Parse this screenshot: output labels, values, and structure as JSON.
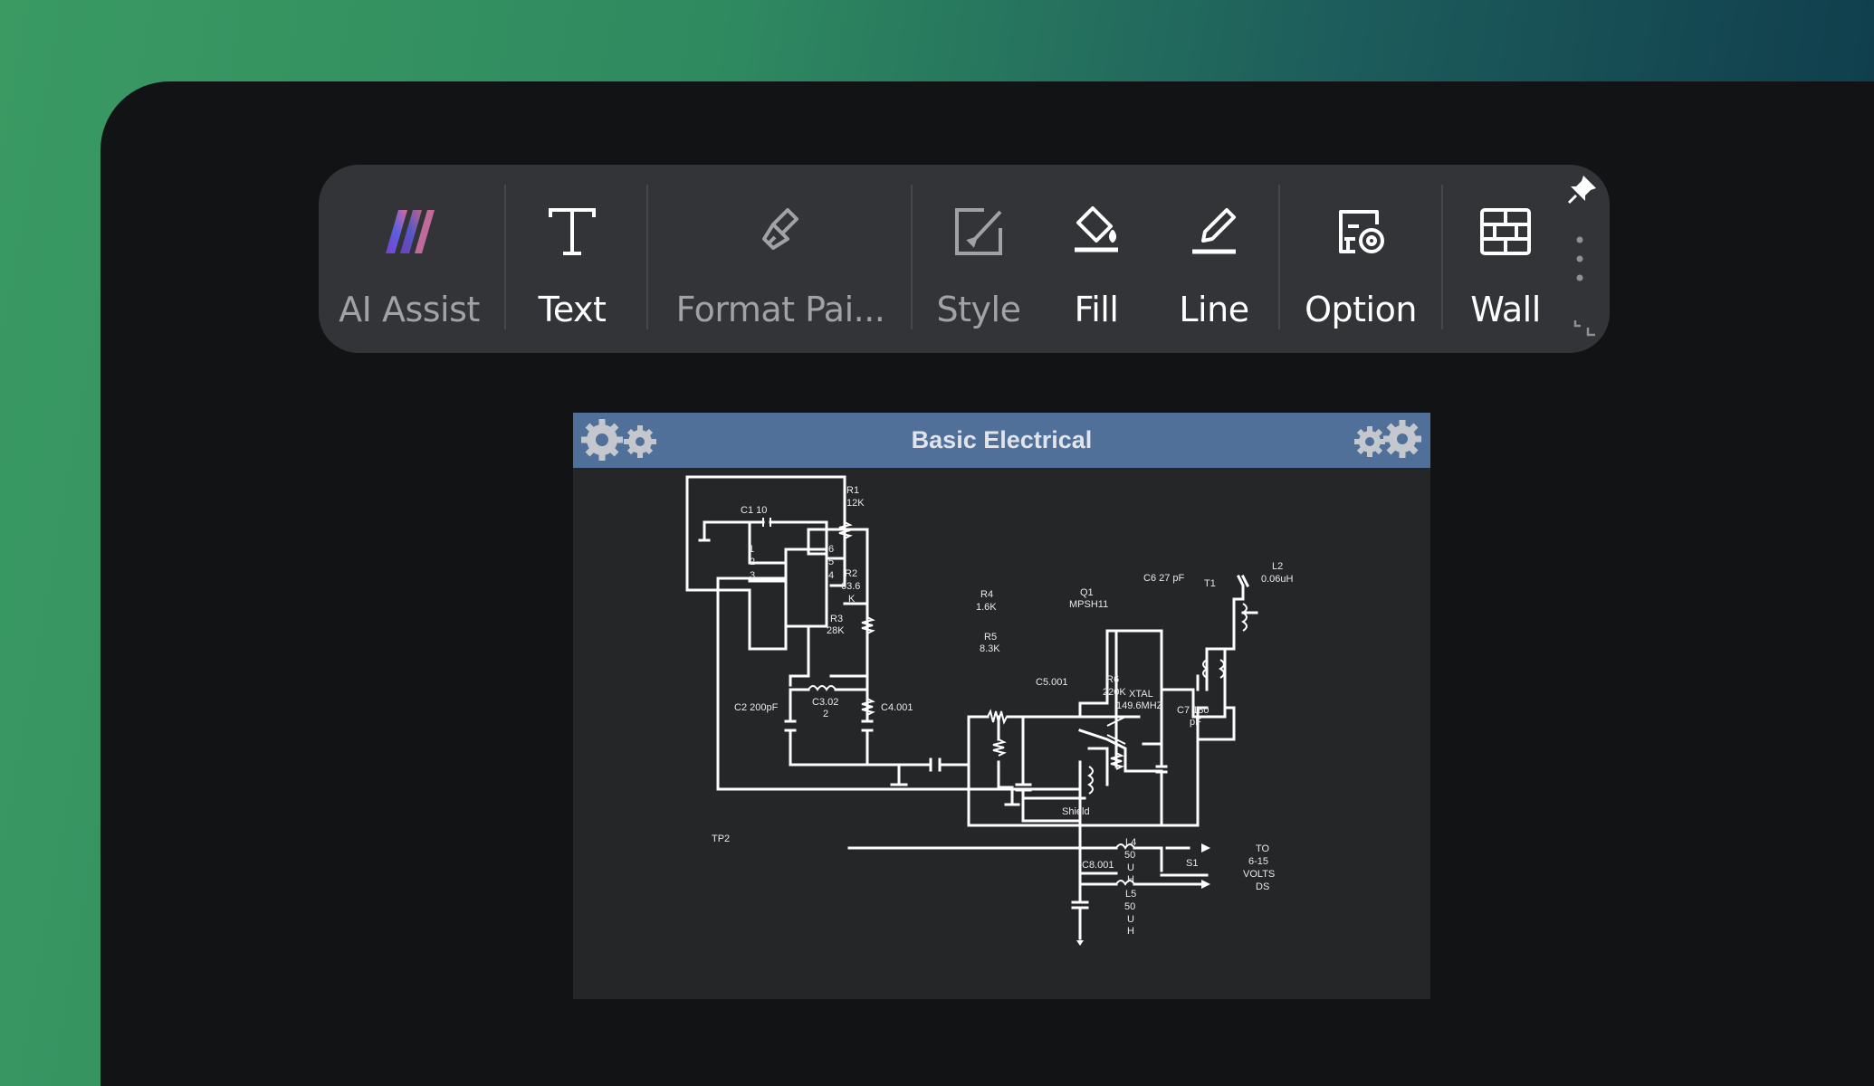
{
  "toolbar": {
    "tools": [
      {
        "label": "AI Assist",
        "icon": "ai-assist-icon"
      },
      {
        "label": "Text",
        "icon": "text-icon"
      },
      {
        "label": "Format Pai...",
        "icon": "paintbrush-icon"
      },
      {
        "label": "Style",
        "icon": "style-icon"
      },
      {
        "label": "Fill",
        "icon": "paint-bucket-icon"
      },
      {
        "label": "Line",
        "icon": "pen-line-icon"
      },
      {
        "label": "Option",
        "icon": "option-gear-icon"
      },
      {
        "label": "Wall",
        "icon": "wall-icon"
      }
    ],
    "pin_icon": "pin-icon",
    "more_icon": "more-vertical-icon"
  },
  "canvas": {
    "title": "Basic Electrical",
    "colors": {
      "header": "#50709a",
      "background": "#252628",
      "wire": "#ffffff"
    }
  },
  "schematic": {
    "labels": {
      "c1": "C1 10",
      "r1a": "R1",
      "r1b": "12K",
      "r2a": "R2",
      "r2b": "63.6",
      "r2c": "K",
      "r3a": "R3",
      "r3b": "28K",
      "r4a": "R4",
      "r4b": "1.6K",
      "r5a": "R5",
      "r5b": "8.3K",
      "r6a": "R6",
      "r6b": "220K",
      "q1a": "Q1",
      "q1b": "MPSH11",
      "c6": "C6 27 pF",
      "t1": "T1",
      "l2a": "L2",
      "l2b": "0.06uH",
      "c5": "C5.001",
      "xtala": "XTAL",
      "xtalb": "149.6MHZ",
      "c7a": "C7 180",
      "c7b": "pF",
      "c2": "C2 200pF",
      "c3a": "C3.02",
      "c3b": "2",
      "c4": "C4.001",
      "shield": "Shield",
      "tp2": "TP2",
      "l4a": "L4",
      "l4b": "50",
      "l4c": "U",
      "l4d": "H",
      "s1": "S1",
      "c8": "C8.001",
      "l5a": "L5",
      "l5b": "50",
      "l5c": "U",
      "l5d": "H",
      "toa": "TO",
      "tob": "6-15",
      "toc": "VOLTS",
      "tod": "DS",
      "pin1": "1",
      "pin2": "2",
      "pin3": "3",
      "pin6": "6",
      "pin5": "5",
      "pin4": "4"
    }
  }
}
